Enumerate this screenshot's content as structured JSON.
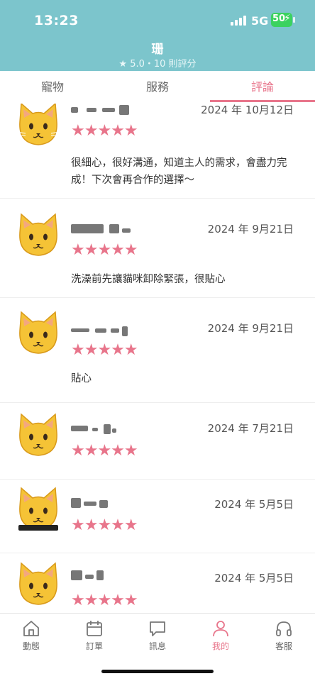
{
  "status_bar": {
    "time": "13:23",
    "network": "5G",
    "battery": "50"
  },
  "header": {
    "title": "珊",
    "subtitle": "★ 5.0・10 則評分"
  },
  "tabs": [
    {
      "label": "寵物",
      "active": false
    },
    {
      "label": "服務",
      "active": false
    },
    {
      "label": "評論",
      "active": true
    }
  ],
  "reviews": [
    {
      "date": "2024 年 10月12日",
      "stars": "★★★★★",
      "text": "很細心，很好溝通，知道主人的需求，會盡力完成！下次會再合作的選擇～",
      "avatar": "cat-face"
    },
    {
      "date": "2024 年 9月21日",
      "stars": "★★★★★",
      "text": "洗澡前先讓貓咪卸除緊張，很貼心",
      "avatar": "cat-face"
    },
    {
      "date": "2024 年 9月21日",
      "stars": "★★★★★",
      "text": "貼心",
      "avatar": "cat-face"
    },
    {
      "date": "2024 年 7月21日",
      "stars": "★★★★★",
      "text": "",
      "avatar": "cat-face"
    },
    {
      "date": "2024 年 5月5日",
      "stars": "★★★★★",
      "text": "",
      "avatar": "cat-face"
    },
    {
      "date": "2024 年 5月5日",
      "stars": "★★★★★",
      "text": "",
      "avatar": "cat-face"
    }
  ],
  "bottom_nav": [
    {
      "label": "動態",
      "icon": "home-icon",
      "active": false
    },
    {
      "label": "訂單",
      "icon": "calendar-icon",
      "active": false
    },
    {
      "label": "訊息",
      "icon": "chat-icon",
      "active": false
    },
    {
      "label": "我的",
      "icon": "user-icon",
      "active": true
    },
    {
      "label": "客服",
      "icon": "headset-icon",
      "active": false
    }
  ],
  "colors": {
    "header_bg": "#7cc5cc",
    "accent": "#e8758b",
    "battery": "#3bd25f"
  }
}
